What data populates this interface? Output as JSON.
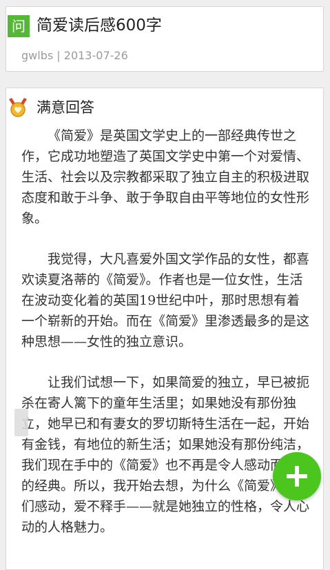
{
  "question": {
    "badge": "问",
    "title": "简爱读后感600字",
    "author": "gwlbs",
    "separator": "|",
    "date": "2013-07-26"
  },
  "answer": {
    "heading": "满意回答",
    "paragraphs": [
      "《简爱》是英国文学史上的一部经典传世之作，它成功地塑造了英国文学史中第一个对爱情、生活、社会以及宗教都采取了独立自主的积极进取态度和敢于斗争、敢于争取自由平等地位的女性形象。",
      "我觉得，大凡喜爱外国文学作品的女性，都喜欢读夏洛蒂的《简爱》。作者也是一位女性，生活在波动变化着的英国19世纪中叶，那时思想有着一个崭新的开始。而在《简爱》里渗透最多的是这种思想——女性的独立意识。",
      "让我们试想一下，如果简爱的独立，早已被扼杀在寄人篱下的童年生活里；如果她没有那份独立，她早已和有妻女的罗切斯特生活在一起，开始有金钱，有地位的新生活；如果她没有那份纯洁，我们现在手中的《简爱》也不再是令人感动而流泪的经典。所以，我开始去想，为什么《简爱》让我们感动，爱不释手——就是她独立的性格，令人心动的人格魅力。"
    ]
  },
  "colors": {
    "accent_green": "#55b737",
    "fab_green": "#4cc51f",
    "medal_gold": "#e9a825"
  },
  "icons": {
    "medal": "medal-icon",
    "fab": "plus-icon"
  }
}
